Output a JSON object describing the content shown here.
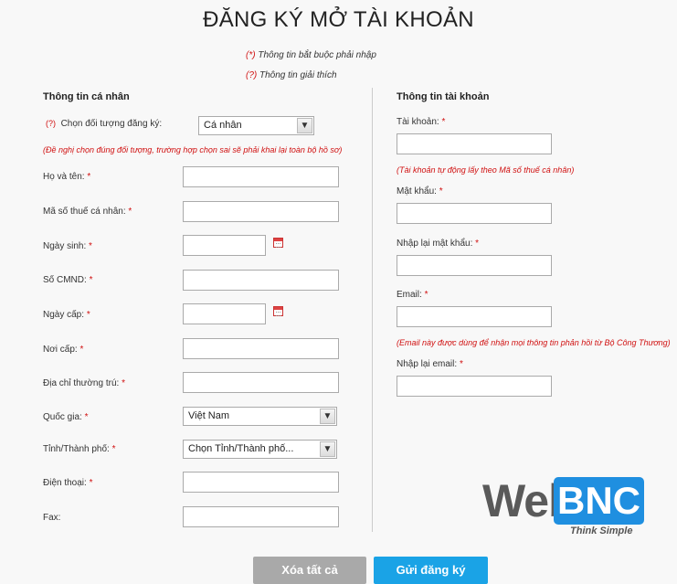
{
  "title": "ĐĂNG KÝ MỞ TÀI KHOẢN",
  "notes": {
    "required_mark": "(*)",
    "required_text": " Thông tin bắt buộc phải nhập",
    "explain_mark": "(?)",
    "explain_text": " Thông tin giải thích"
  },
  "personal": {
    "heading": "Thông tin cá nhân",
    "subject_help": "(?)",
    "subject_label": "Chọn đối tượng đăng ký:",
    "subject_value": "Cá nhân",
    "subject_hint": "(Đề nghị chọn đúng đối tượng, trường hợp chọn sai sẽ phải khai lại toàn bộ hồ sơ)",
    "fields": {
      "fullname": "Họ và tên:",
      "tax_code": "Mã số thuế cá nhân:",
      "dob": "Ngày sinh:",
      "id_number": "Số CMND:",
      "issue_date": "Ngày cấp:",
      "issue_place": "Nơi cấp:",
      "address": "Địa chỉ thường trú:",
      "country": "Quốc gia:",
      "province": "Tỉnh/Thành phố:",
      "phone": "Điện thoại:",
      "fax": "Fax:"
    },
    "country_value": "Việt Nam",
    "province_value": "Chọn Tỉnh/Thành phố..."
  },
  "account": {
    "heading": "Thông tin tài khoản",
    "fields": {
      "username": "Tài khoản:",
      "password": "Mật khẩu:",
      "password_confirm": "Nhập lại mật khẩu:",
      "email": "Email:",
      "email_confirm": "Nhập lại email:"
    },
    "username_hint": "(Tài khoản tự động lấy theo Mã số thuế cá nhân)",
    "email_hint": "(Email này được dùng để nhận mọi thông tin phản hồi từ Bộ Công Thương)"
  },
  "required_star": "*",
  "buttons": {
    "clear": "Xóa tất cả",
    "submit": "Gửi đăng ký"
  },
  "logo": {
    "web": "Web",
    "bnc": "BNC",
    "tagline": "Think Simple"
  },
  "colors": {
    "required": "#d01010",
    "submit": "#1aa3e6",
    "clear": "#a9a9a9",
    "logo_blue": "#1f8fe0"
  }
}
